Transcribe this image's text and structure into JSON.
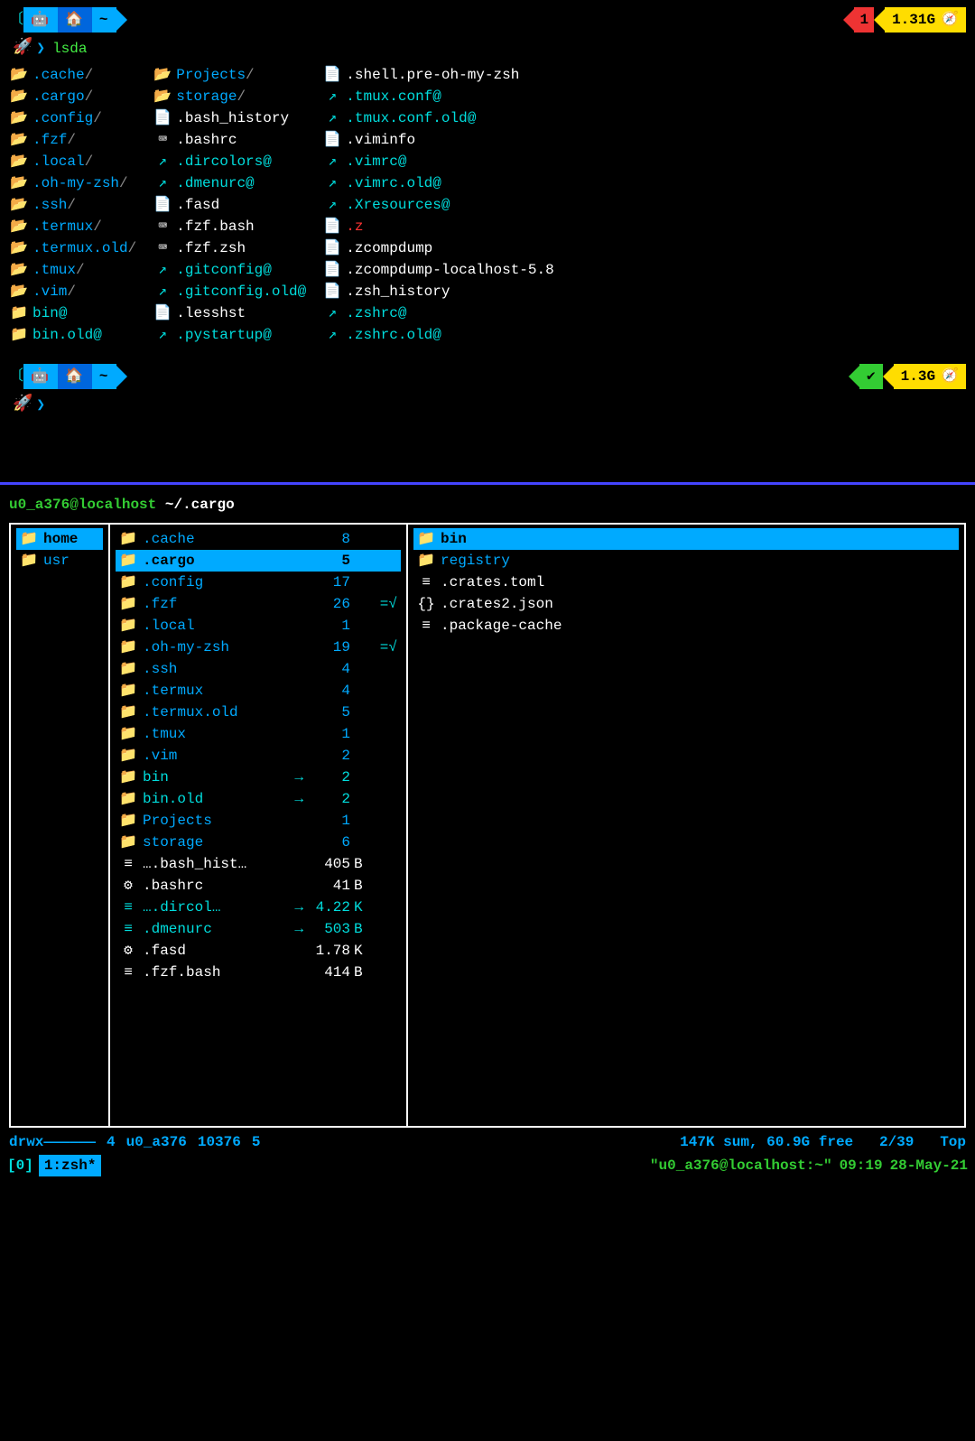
{
  "prompt1": {
    "tilde": "~",
    "cmd": "lsda",
    "status_warn": "1",
    "status_mem": "1.31G"
  },
  "ls": {
    "col1": [
      {
        "icon": "📂",
        "name": ".cache",
        "cls": "c-blue",
        "trail": "/"
      },
      {
        "icon": "📂",
        "name": ".cargo",
        "cls": "c-blue",
        "trail": "/"
      },
      {
        "icon": "📂",
        "name": ".config",
        "cls": "c-blue",
        "trail": "/"
      },
      {
        "icon": "📂",
        "name": ".fzf",
        "cls": "c-blue",
        "trail": "/"
      },
      {
        "icon": "📂",
        "name": ".local",
        "cls": "c-blue",
        "trail": "/"
      },
      {
        "icon": "📂",
        "name": ".oh-my-zsh",
        "cls": "c-blue",
        "trail": "/"
      },
      {
        "icon": "📂",
        "name": ".ssh",
        "cls": "c-blue",
        "trail": "/"
      },
      {
        "icon": "📂",
        "name": ".termux",
        "cls": "c-blue",
        "trail": "/"
      },
      {
        "icon": "📂",
        "name": ".termux.old",
        "cls": "c-blue",
        "trail": "/"
      },
      {
        "icon": "📂",
        "name": ".tmux",
        "cls": "c-blue",
        "trail": "/"
      },
      {
        "icon": "📂",
        "name": ".vim",
        "cls": "c-blue",
        "trail": "/"
      },
      {
        "icon": "📁",
        "name": "bin",
        "cls": "c-teal",
        "trail": "@"
      },
      {
        "icon": "📁",
        "name": "bin.old",
        "cls": "c-teal",
        "trail": "@"
      }
    ],
    "col2": [
      {
        "icon": "📂",
        "name": "Projects",
        "cls": "c-blue",
        "trail": "/"
      },
      {
        "icon": "📂",
        "name": "storage",
        "cls": "c-blue",
        "trail": "/"
      },
      {
        "icon": "📄",
        "name": ".bash_history",
        "cls": "c-white",
        "trail": ""
      },
      {
        "icon": "⌨",
        "name": ".bashrc",
        "cls": "c-white",
        "trail": ""
      },
      {
        "icon": "↗",
        "name": ".dircolors",
        "cls": "c-teal",
        "trail": "@"
      },
      {
        "icon": "↗",
        "name": ".dmenurc",
        "cls": "c-teal",
        "trail": "@"
      },
      {
        "icon": "📄",
        "name": ".fasd",
        "cls": "c-white",
        "trail": ""
      },
      {
        "icon": "⌨",
        "name": ".fzf.bash",
        "cls": "c-white",
        "trail": ""
      },
      {
        "icon": "⌨",
        "name": ".fzf.zsh",
        "cls": "c-white",
        "trail": ""
      },
      {
        "icon": "↗",
        "name": ".gitconfig",
        "cls": "c-teal",
        "trail": "@"
      },
      {
        "icon": "↗",
        "name": ".gitconfig.old",
        "cls": "c-teal",
        "trail": "@"
      },
      {
        "icon": "📄",
        "name": ".lesshst",
        "cls": "c-white",
        "trail": ""
      },
      {
        "icon": "↗",
        "name": ".pystartup",
        "cls": "c-teal",
        "trail": "@"
      }
    ],
    "col3": [
      {
        "icon": "📄",
        "name": ".shell.pre-oh-my-zsh",
        "cls": "c-white",
        "trail": ""
      },
      {
        "icon": "↗",
        "name": ".tmux.conf",
        "cls": "c-teal",
        "trail": "@"
      },
      {
        "icon": "↗",
        "name": ".tmux.conf.old",
        "cls": "c-teal",
        "trail": "@"
      },
      {
        "icon": "📄",
        "name": ".viminfo",
        "cls": "c-white",
        "trail": ""
      },
      {
        "icon": "↗",
        "name": ".vimrc",
        "cls": "c-teal",
        "trail": "@"
      },
      {
        "icon": "↗",
        "name": ".vimrc.old",
        "cls": "c-teal",
        "trail": "@"
      },
      {
        "icon": "↗",
        "name": ".Xresources",
        "cls": "c-teal",
        "trail": "@"
      },
      {
        "icon": "📄",
        "name": ".z",
        "cls": "c-red",
        "trail": ""
      },
      {
        "icon": "📄",
        "name": ".zcompdump",
        "cls": "c-white",
        "trail": ""
      },
      {
        "icon": "📄",
        "name": ".zcompdump-localhost-5.8",
        "cls": "c-white",
        "trail": ""
      },
      {
        "icon": "📄",
        "name": ".zsh_history",
        "cls": "c-white",
        "trail": ""
      },
      {
        "icon": "↗",
        "name": ".zshrc",
        "cls": "c-teal",
        "trail": "@"
      },
      {
        "icon": "↗",
        "name": ".zshrc.old",
        "cls": "c-teal",
        "trail": "@"
      }
    ]
  },
  "prompt2": {
    "tilde": "~",
    "status_ok": "✔",
    "status_mem": "1.3G"
  },
  "ranger": {
    "user": "u0_a376",
    "host": "localhost",
    "path": "~/",
    "current": ".cargo",
    "col1": [
      {
        "icon": "📁",
        "name": "home",
        "sel": true
      },
      {
        "icon": "📁",
        "name": "usr",
        "sel": false
      }
    ],
    "col2": [
      {
        "icon": "📁",
        "name": ".cache",
        "type": "dir",
        "size": "8",
        "unit": "",
        "flag": "",
        "sel": false
      },
      {
        "icon": "📁",
        "name": ".cargo",
        "type": "dir",
        "size": "5",
        "unit": "",
        "flag": "",
        "sel": true
      },
      {
        "icon": "📁",
        "name": ".config",
        "type": "dir",
        "size": "17",
        "unit": "",
        "flag": "",
        "sel": false
      },
      {
        "icon": "📁",
        "name": ".fzf",
        "type": "dir",
        "size": "26",
        "unit": "",
        "flag": "=√",
        "sel": false
      },
      {
        "icon": "📁",
        "name": ".local",
        "type": "dir",
        "size": "1",
        "unit": "",
        "flag": "",
        "sel": false
      },
      {
        "icon": "📁",
        "name": ".oh-my-zsh",
        "type": "dir",
        "size": "19",
        "unit": "",
        "flag": "=√",
        "sel": false
      },
      {
        "icon": "📁",
        "name": ".ssh",
        "type": "dir",
        "size": "4",
        "unit": "",
        "flag": "",
        "sel": false
      },
      {
        "icon": "📁",
        "name": ".termux",
        "type": "dir",
        "size": "4",
        "unit": "",
        "flag": "",
        "sel": false
      },
      {
        "icon": "📁",
        "name": ".termux.old",
        "type": "dir",
        "size": "5",
        "unit": "",
        "flag": "",
        "sel": false
      },
      {
        "icon": "📁",
        "name": ".tmux",
        "type": "dir",
        "size": "1",
        "unit": "",
        "flag": "",
        "sel": false
      },
      {
        "icon": "📁",
        "name": ".vim",
        "type": "dir",
        "size": "2",
        "unit": "",
        "flag": "",
        "sel": false
      },
      {
        "icon": "📁",
        "name": "bin",
        "type": "link",
        "arrow": "→",
        "size": "2",
        "unit": "",
        "flag": "",
        "sel": false
      },
      {
        "icon": "📁",
        "name": "bin.old",
        "type": "link",
        "arrow": "→",
        "size": "2",
        "unit": "",
        "flag": "",
        "sel": false
      },
      {
        "icon": "📁",
        "name": "Projects",
        "type": "dir",
        "size": "1",
        "unit": "",
        "flag": "",
        "sel": false
      },
      {
        "icon": "📁",
        "name": "storage",
        "type": "dir",
        "size": "6",
        "unit": "",
        "flag": "",
        "sel": false
      },
      {
        "icon": "≡",
        "name": "….bash_hist…",
        "type": "file",
        "size": "405",
        "unit": "B",
        "flag": "",
        "sel": false
      },
      {
        "icon": "⚙",
        "name": ".bashrc",
        "type": "file",
        "size": "41",
        "unit": "B",
        "flag": "",
        "sel": false
      },
      {
        "icon": "≡",
        "name": "….dircol…",
        "type": "link",
        "arrow": "→",
        "size": "4.22",
        "unit": "K",
        "flag": "",
        "sel": false
      },
      {
        "icon": "≡",
        "name": ".dmenurc",
        "type": "link",
        "arrow": "→",
        "size": "503",
        "unit": "B",
        "flag": "",
        "sel": false
      },
      {
        "icon": "⚙",
        "name": ".fasd",
        "type": "file",
        "size": "1.78",
        "unit": "K",
        "flag": "",
        "sel": false
      },
      {
        "icon": "≡",
        "name": ".fzf.bash",
        "type": "file",
        "size": "414",
        "unit": "B",
        "flag": "",
        "sel": false
      }
    ],
    "col3": [
      {
        "icon": "📁",
        "name": "bin",
        "type": "dir",
        "sel": true
      },
      {
        "icon": "📁",
        "name": "registry",
        "type": "dir",
        "sel": false
      },
      {
        "icon": "≡",
        "name": ".crates.toml",
        "type": "file",
        "sel": false
      },
      {
        "icon": "{}",
        "name": ".crates2.json",
        "type": "file",
        "sel": false
      },
      {
        "icon": "≡",
        "name": ".package-cache",
        "type": "file",
        "sel": false
      }
    ]
  },
  "status": {
    "perms": "drwx",
    "dashes": "——————",
    "links": "4",
    "owner": "u0_a376",
    "group": "10376",
    "count": "5",
    "sum": "147K sum,",
    "free": "60.9G free",
    "pos": "2/39",
    "top": "Top"
  },
  "tmux": {
    "session": "[0]",
    "window": "1:zsh*",
    "title": "\"u0_a376@localhost:~\"",
    "time": "09:19",
    "date": "28-May-21"
  }
}
